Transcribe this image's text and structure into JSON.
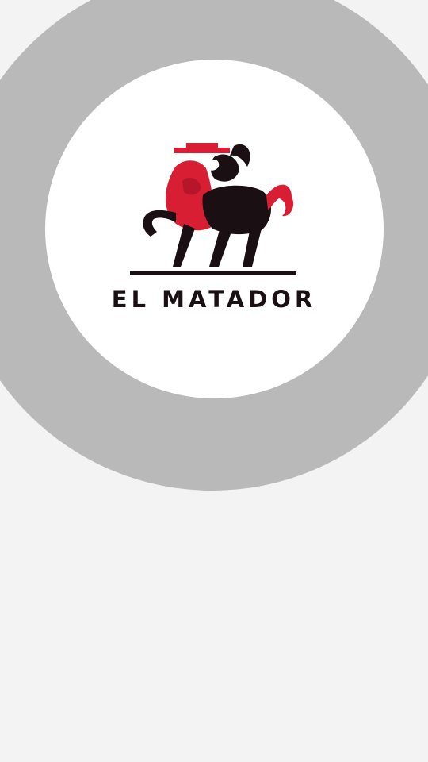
{
  "splash": {
    "brand_name": "EL MATADOR",
    "logo_icon": "bull-with-red-cape-icon"
  },
  "colors": {
    "background": "#f3f3f3",
    "ring": "#b9b9b9",
    "disc": "#ffffff",
    "brand_red": "#d81e33",
    "brand_dark": "#1a0f12"
  }
}
